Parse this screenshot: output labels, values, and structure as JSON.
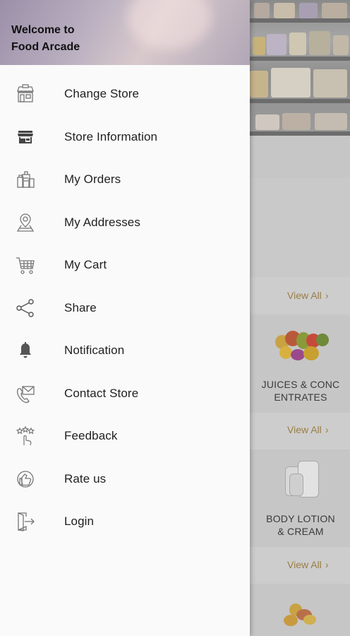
{
  "drawer": {
    "welcome_line1": "Welcome to",
    "welcome_line2": "Food Arcade",
    "items": [
      {
        "label": "Change Store",
        "icon": "store-switch-icon"
      },
      {
        "label": "Store Information",
        "icon": "storefront-icon"
      },
      {
        "label": "My Orders",
        "icon": "orders-icon"
      },
      {
        "label": "My Addresses",
        "icon": "location-pin-icon"
      },
      {
        "label": "My Cart",
        "icon": "cart-icon"
      },
      {
        "label": "Share",
        "icon": "share-icon"
      },
      {
        "label": "Notification",
        "icon": "bell-icon"
      },
      {
        "label": "Contact Store",
        "icon": "phone-mail-icon"
      },
      {
        "label": "Feedback",
        "icon": "feedback-stars-icon"
      },
      {
        "label": "Rate us",
        "icon": "rate-us-icon"
      },
      {
        "label": "Login",
        "icon": "login-icon"
      }
    ]
  },
  "background": {
    "view_all_label": "View All",
    "categories": [
      {
        "label_line1": "JUICES & CONC",
        "label_line2": "ENTRATES"
      },
      {
        "label_line1": "BODY LOTION",
        "label_line2": "& CREAM"
      }
    ]
  },
  "colors": {
    "accent_view_all": "#9a7d45",
    "drawer_bg": "#fafafa",
    "overlay": "#c9c9c9"
  }
}
